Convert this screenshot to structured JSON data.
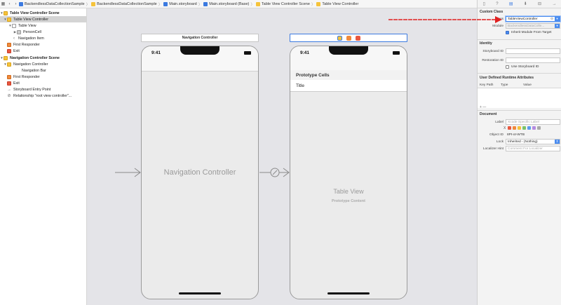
{
  "jumpbar": {
    "crumbs": [
      {
        "label": "BackendlessDataCollectionSample",
        "color": "#3b7ae0"
      },
      {
        "label": "BackendlessDataCollectionSample",
        "color": "#f5c33b"
      },
      {
        "label": "Main.storyboard",
        "color": "#3b7ae0"
      },
      {
        "label": "Main.storyboard (Base)",
        "color": "#3b7ae0"
      },
      {
        "label": "Table View Controller Scene",
        "color": "#f5c33b"
      },
      {
        "label": "Table View Controller",
        "color": "#f5c33b"
      }
    ]
  },
  "outline": {
    "items": [
      {
        "label": "Table View Controller Scene",
        "icon": "scene-icon"
      },
      {
        "label": "Table View Controller",
        "icon": "view-controller-icon"
      },
      {
        "label": "Table View",
        "icon": "table-view-icon"
      },
      {
        "label": "PersonCell",
        "icon": "table-cell-icon"
      },
      {
        "label": "Navigation Item",
        "icon": "navigation-item-icon"
      },
      {
        "label": "First Responder",
        "icon": "first-responder-icon"
      },
      {
        "label": "Exit",
        "icon": "exit-icon"
      },
      {
        "label": "Navigation Controller Scene",
        "icon": "scene-icon"
      },
      {
        "label": "Navigation Controller",
        "icon": "navigation-controller-icon"
      },
      {
        "label": "Navigation Bar",
        "icon": "navigation-bar-icon"
      },
      {
        "label": "First Responder",
        "icon": "first-responder-icon"
      },
      {
        "label": "Exit",
        "icon": "exit-icon"
      },
      {
        "label": "Storyboard Entry Point",
        "icon": "arrow-right-icon"
      },
      {
        "label": "Relationship \"root view controller\"...",
        "icon": "relationship-icon"
      }
    ]
  },
  "canvas": {
    "nav_controller": {
      "title": "Navigation Controller",
      "time": "9:41",
      "center_label": "Navigation Controller"
    },
    "table_controller": {
      "time": "9:41",
      "prototype_header": "Prototype Cells",
      "cell_title": "Title",
      "table_label": "Table View",
      "table_sublabel": "Prototype Content"
    }
  },
  "inspector": {
    "custom_class": {
      "header": "Custom Class",
      "class_label": "Class",
      "class_value": "TableViewController",
      "module_label": "Module",
      "module_placeholder": "BackendlessDataColle...",
      "inherit_label": "Inherit Module From Target"
    },
    "identity": {
      "header": "Identity",
      "storyboard_id_label": "Storyboard ID",
      "restoration_id_label": "Restoration ID",
      "use_storyboard_id_label": "Use Storyboard ID"
    },
    "runtime_attrs": {
      "header": "User Defined Runtime Attributes",
      "col_keypath": "Key Path",
      "col_type": "Type",
      "col_value": "Value",
      "add_remove": "+  —"
    },
    "document": {
      "header": "Document",
      "label_label": "Label",
      "label_placeholder": "Xcode Specific Label",
      "object_id_label": "Object ID",
      "object_id_value": "8Pt-ot-WTB",
      "lock_label": "Lock",
      "lock_value": "Inherited - (Nothing)",
      "localizer_hint_label": "Localizer Hint",
      "localizer_hint_placeholder": "Comment For Localizer",
      "clear_mark": "X"
    }
  },
  "colors": {
    "selection_blue": "#3b7ae0",
    "annotation_arrow": "#e02020",
    "canvas_bg": "#e4e4e8"
  }
}
